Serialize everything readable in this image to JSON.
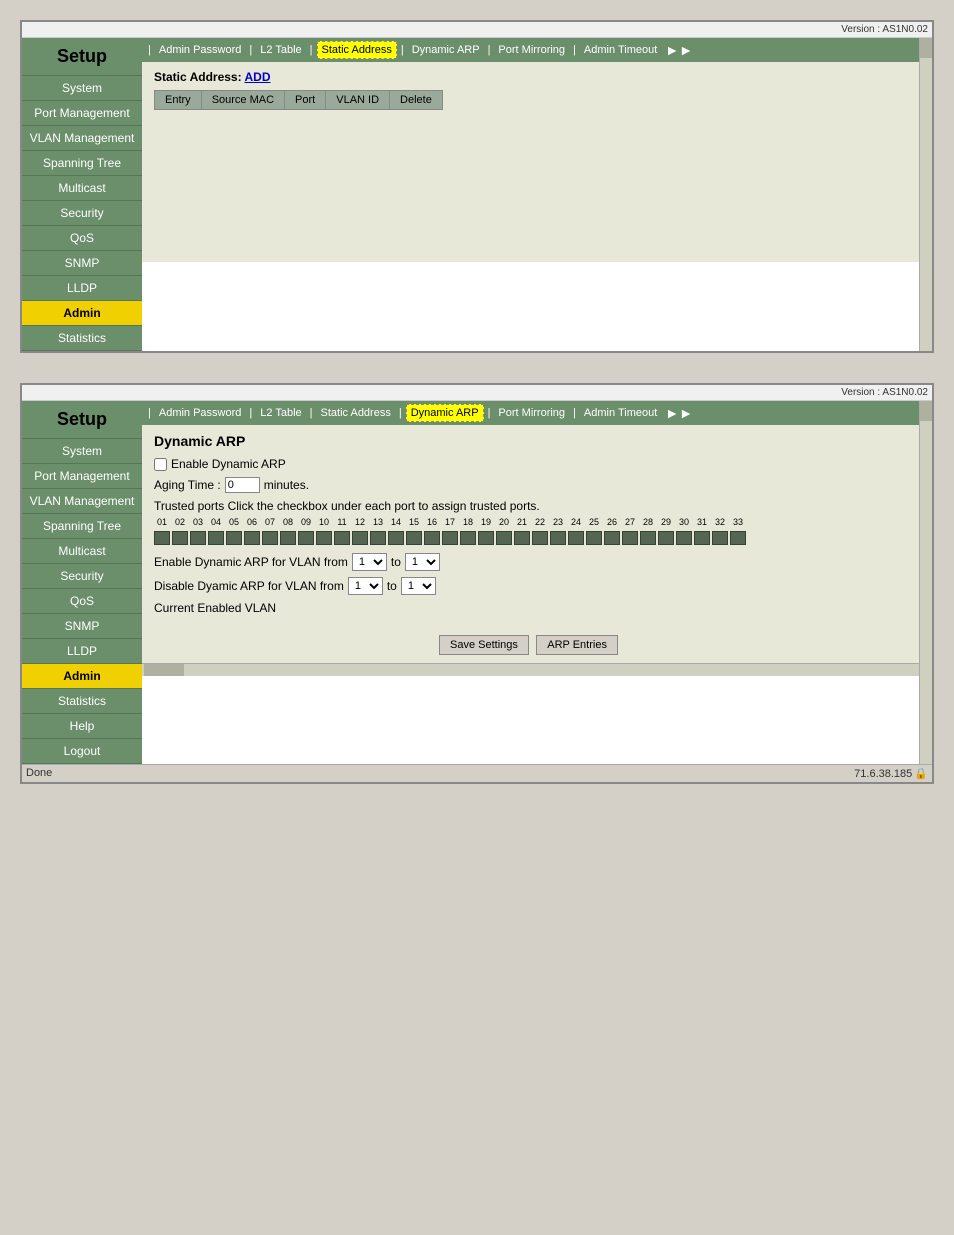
{
  "window1": {
    "version": "Version : AS1N0.02",
    "sidebar": {
      "title": "Setup",
      "items": [
        {
          "label": "System",
          "active": false
        },
        {
          "label": "Port Management",
          "active": false
        },
        {
          "label": "VLAN Management",
          "active": false
        },
        {
          "label": "Spanning Tree",
          "active": false
        },
        {
          "label": "Multicast",
          "active": false
        },
        {
          "label": "Security",
          "active": false
        },
        {
          "label": "QoS",
          "active": false
        },
        {
          "label": "SNMP",
          "active": false
        },
        {
          "label": "LLDP",
          "active": false
        },
        {
          "label": "Admin",
          "active": true
        },
        {
          "label": "Statistics",
          "active": false
        }
      ]
    },
    "tabs": [
      {
        "label": "Admin Password",
        "active": false
      },
      {
        "label": "L2 Table",
        "active": false
      },
      {
        "label": "Static Address",
        "active": true
      },
      {
        "label": "Dynamic ARP",
        "active": false
      },
      {
        "label": "Port Mirroring",
        "active": false
      },
      {
        "label": "Admin Timeout",
        "active": false
      }
    ],
    "content": {
      "section_label": "Static Address:",
      "add_link": "ADD",
      "table_headers": [
        "Entry",
        "Source MAC",
        "Port",
        "VLAN ID",
        "Delete"
      ]
    }
  },
  "window2": {
    "version": "Version : AS1N0.02",
    "sidebar": {
      "title": "Setup",
      "items": [
        {
          "label": "System",
          "active": false
        },
        {
          "label": "Port Management",
          "active": false
        },
        {
          "label": "VLAN Management",
          "active": false
        },
        {
          "label": "Spanning Tree",
          "active": false
        },
        {
          "label": "Multicast",
          "active": false
        },
        {
          "label": "Security",
          "active": false
        },
        {
          "label": "QoS",
          "active": false
        },
        {
          "label": "SNMP",
          "active": false
        },
        {
          "label": "LLDP",
          "active": false
        },
        {
          "label": "Admin",
          "active": true
        },
        {
          "label": "Statistics",
          "active": false
        },
        {
          "label": "Help",
          "active": false
        },
        {
          "label": "Logout",
          "active": false
        }
      ]
    },
    "tabs": [
      {
        "label": "Admin Password",
        "active": false
      },
      {
        "label": "L2 Table",
        "active": false
      },
      {
        "label": "Static Address",
        "active": false
      },
      {
        "label": "Dynamic ARP",
        "active": true
      },
      {
        "label": "Port Mirroring",
        "active": false
      },
      {
        "label": "Admin Timeout",
        "active": false
      }
    ],
    "dynamic_arp": {
      "title": "Dynamic ARP",
      "enable_label": "Enable Dynamic ARP",
      "aging_time_label": "Aging Time :",
      "aging_time_value": "0",
      "aging_time_unit": "minutes.",
      "trusted_ports_label": "Trusted ports   Click the checkbox under each port to assign trusted ports.",
      "port_numbers": [
        "01",
        "02",
        "03",
        "04",
        "05",
        "06",
        "07",
        "08",
        "09",
        "10",
        "11",
        "12",
        "13",
        "14",
        "15",
        "16",
        "17",
        "18",
        "19",
        "20",
        "21",
        "22",
        "23",
        "24",
        "25",
        "26",
        "27",
        "28",
        "29",
        "30",
        "31",
        "32",
        "33"
      ],
      "enable_vlan_label": "Enable Dynamic ARP for VLAN from",
      "enable_vlan_to": "to",
      "disable_vlan_label": "Disable Dyamic ARP for VLAN from",
      "disable_vlan_to": "to",
      "current_vlan_label": "Current Enabled VLAN",
      "save_button": "Save Settings",
      "arp_entries_button": "ARP Entries"
    },
    "status_bar": {
      "status": "Done",
      "ip": "71.6.38.185"
    }
  }
}
